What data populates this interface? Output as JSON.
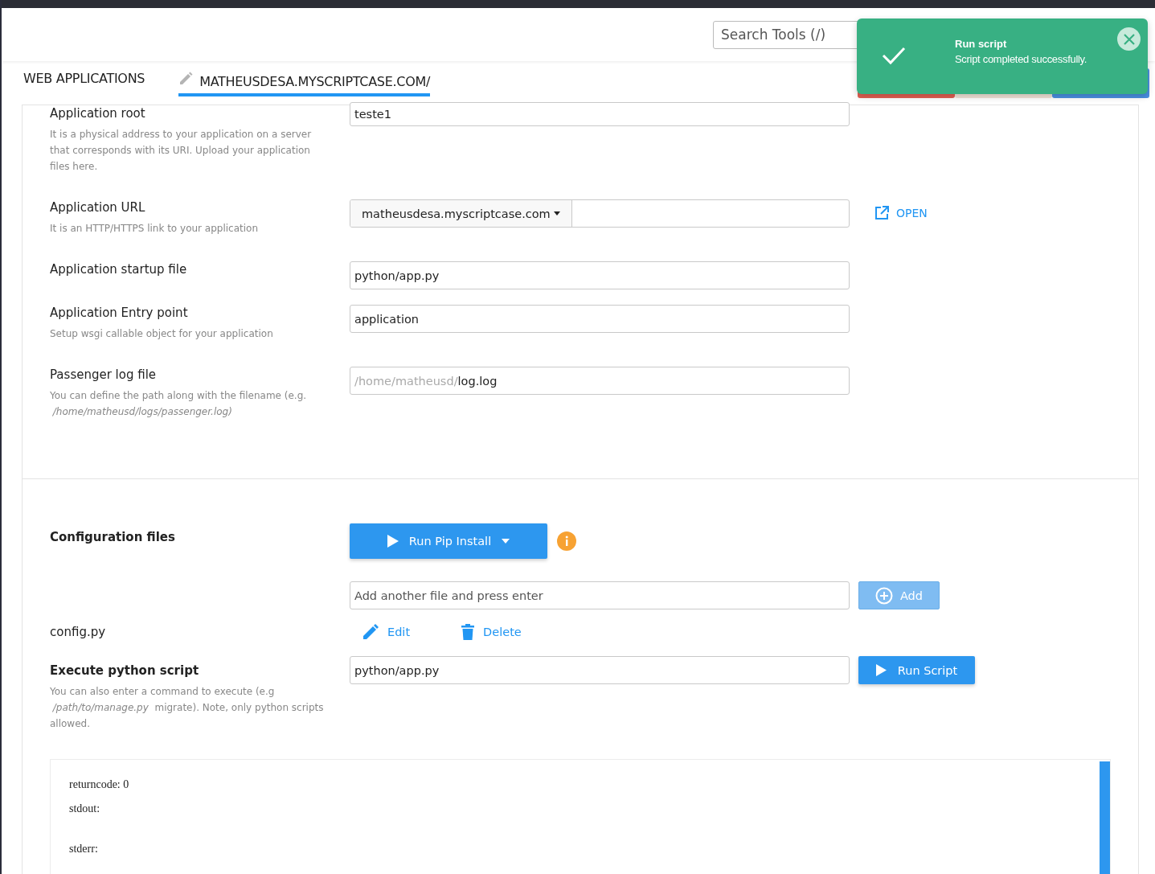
{
  "header": {
    "search": {
      "placeholder": "Search Tools (/)"
    }
  },
  "toast": {
    "title": "Run script",
    "message": "Script completed successfully."
  },
  "toolbar_buttons": [
    {
      "kind": "danger"
    },
    {
      "kind": "plain"
    },
    {
      "kind": "primary"
    }
  ],
  "tabs": [
    {
      "label": "WEB APPLICATIONS",
      "selected": false
    },
    {
      "label": "MATHEUSDESA.MYSCRIPTCASE.COM/",
      "selected": true
    }
  ],
  "fields": [
    {
      "kind": "text",
      "label": "Application root",
      "help": "It is a physical address to your application on a server that corresponds with its URI. Upload your application files here.",
      "value": "teste1"
    },
    {
      "kind": "url",
      "label": "Application URL",
      "help": "It is an HTTP/HTTPS link to your application",
      "domain": "matheusdesa.myscriptcase.com",
      "link": "OPEN"
    },
    {
      "kind": "text",
      "label": "Application startup file",
      "value": "python/app.py"
    },
    {
      "kind": "text",
      "label": "Application Entry point",
      "help": "Setup wsgi callable object for your application",
      "value": "application"
    },
    {
      "kind": "path",
      "label": "Passenger log file",
      "help": "You can define the path along with the filename (e.g.  */home/matheusd/logs/passenger.log)*",
      "prefix": "/home/matheusd/",
      "value": "log.log"
    }
  ],
  "config": {
    "title": "Configuration files",
    "pip_button": "Run Pip Install",
    "add_field": {
      "placeholder": "Add another file and press enter"
    },
    "add_button": "Add",
    "files": [
      {
        "name": "config.py",
        "edit": "Edit",
        "delete": "Delete"
      }
    ]
  },
  "execute": {
    "title": "Execute python script",
    "help": "You can also enter a command to execute (e.g  */path/to/manage.py*  migrate). Note, only python scripts allowed.",
    "value": "python/app.py",
    "button": "Run Script"
  },
  "output": {
    "returncode": "returncode: 0",
    "stdout": "stdout:",
    "stderr": "stderr:"
  }
}
